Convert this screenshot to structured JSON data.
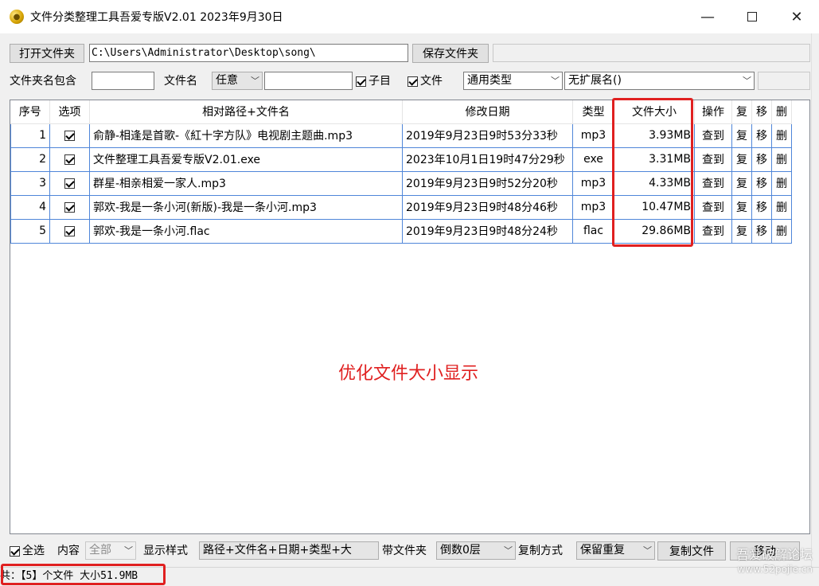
{
  "window": {
    "title": "文件分类整理工具吾爱专版V2.01  2023年9月30日",
    "minimize_glyph": "—",
    "close_glyph": "✕"
  },
  "toolbar1": {
    "open_folder_label": "打开文件夹",
    "path_value": "C:\\Users\\Administrator\\Desktop\\song\\",
    "save_folder_label": "保存文件夹"
  },
  "toolbar2": {
    "folder_name_contains_label": "文件夹名包含",
    "folder_name_contains_value": "",
    "filename_label": "文件名",
    "filename_mode_value": "任意",
    "filename_value": "",
    "subdir_label": "子目",
    "file_label": "文件",
    "type_select_value": "通用类型",
    "ext_select_value": "无扩展名()"
  },
  "table": {
    "headers": [
      "序号",
      "选项",
      "相对路径+文件名",
      "修改日期",
      "类型",
      "文件大小",
      "操作",
      "复",
      "移",
      "删"
    ],
    "rows": [
      {
        "idx": "1",
        "name": "俞静-相逢是首歌-《紅十字方队》电视剧主题曲.mp3",
        "date": "2019年9月23日9时53分33秒",
        "type": "mp3",
        "size": "3.93MB",
        "op": "查到",
        "copy": "复",
        "move": "移",
        "del": "删"
      },
      {
        "idx": "2",
        "name": "文件整理工具吾爱专版V2.01.exe",
        "date": "2023年10月1日19时47分29秒",
        "type": "exe",
        "size": "3.31MB",
        "op": "查到",
        "copy": "复",
        "move": "移",
        "del": "删"
      },
      {
        "idx": "3",
        "name": "群星-相亲相爱一家人.mp3",
        "date": "2019年9月23日9时52分20秒",
        "type": "mp3",
        "size": "4.33MB",
        "op": "查到",
        "copy": "复",
        "move": "移",
        "del": "删"
      },
      {
        "idx": "4",
        "name": "郭欢-我是一条小河(新版)-我是一条小河.mp3",
        "date": "2019年9月23日9时48分46秒",
        "type": "mp3",
        "size": "10.47MB",
        "op": "查到",
        "copy": "复",
        "move": "移",
        "del": "删"
      },
      {
        "idx": "5",
        "name": "郭欢-我是一条小河.flac",
        "date": "2019年9月23日9时48分24秒",
        "type": "flac",
        "size": "29.86MB",
        "op": "查到",
        "copy": "复",
        "move": "移",
        "del": "删"
      }
    ]
  },
  "annotation": {
    "text": "优化文件大小显示",
    "color": "#e02020"
  },
  "bottom": {
    "select_all_label": "全选",
    "content_label": "内容",
    "content_value": "全部",
    "display_style_label": "显示样式",
    "display_style_value": "路径+文件名+日期+类型+大",
    "with_folder_label": "带文件夹",
    "with_folder_value": "倒数0层",
    "copy_mode_label": "复制方式",
    "copy_mode_value": "保留重复",
    "copy_files_label": "复制文件",
    "move_label": "移动"
  },
  "status": {
    "text": "共：【5】个文件  大小51.9MB"
  },
  "watermark": {
    "line1": "吾爱破解论坛",
    "line2": "www.52pojie.cn"
  }
}
